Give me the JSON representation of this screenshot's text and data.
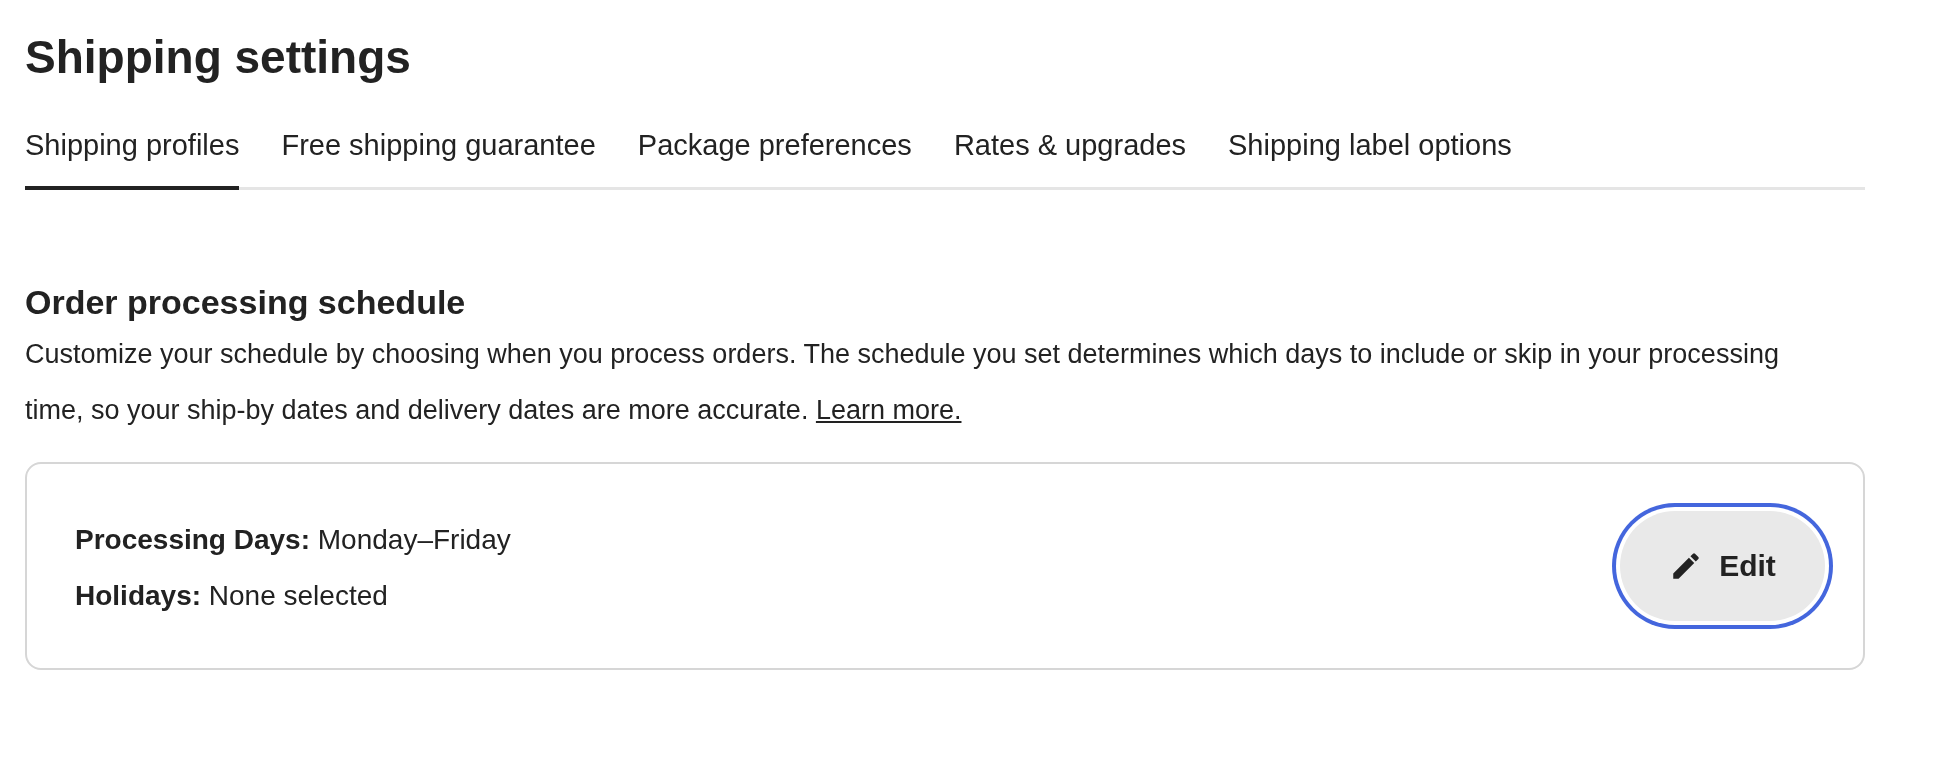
{
  "page": {
    "title": "Shipping settings"
  },
  "tabs": [
    {
      "label": "Shipping profiles",
      "selected": true
    },
    {
      "label": "Free shipping guarantee",
      "selected": false
    },
    {
      "label": "Package preferences",
      "selected": false
    },
    {
      "label": "Rates & upgrades",
      "selected": false
    },
    {
      "label": "Shipping label options",
      "selected": false
    }
  ],
  "section": {
    "heading": "Order processing schedule",
    "description": "Customize your schedule by choosing when you process orders. The schedule you set determines which days to include or skip in your processing time, so your ship-by dates and delivery dates are more accurate.",
    "link": "Learn more.",
    "fields": [
      {
        "label": "Processing Days:",
        "value": "Monday–Friday"
      },
      {
        "label": "Holidays:",
        "value": "None selected"
      }
    ],
    "edit_button": {
      "label": "Edit",
      "focused": true
    }
  }
}
